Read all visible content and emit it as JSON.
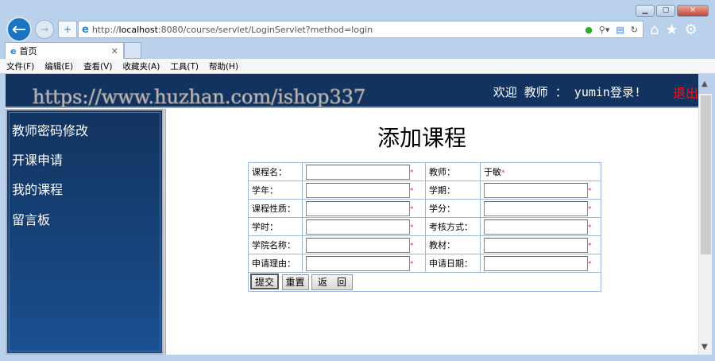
{
  "browser": {
    "url_prefix": "http://",
    "url_host": "localhost",
    "url_rest": ":8080/course/servlet/LoginServlet?method=login",
    "tab_title": "首页",
    "menu": [
      "文件(F)",
      "编辑(E)",
      "查看(V)",
      "收藏夹(A)",
      "工具(T)",
      "帮助(H)"
    ]
  },
  "header": {
    "welcome": "欢迎 教师 ： yumin登录!",
    "logout": "退出"
  },
  "sidebar": {
    "items": [
      "教师密码修改",
      "开课申请",
      "我的课程",
      "留言板"
    ]
  },
  "watermark": "https://www.huzhan.com/ishop337",
  "form": {
    "title": "添加课程",
    "teacher_label": "教师：",
    "teacher_value": "于敏",
    "rows": [
      [
        "课程名：",
        null
      ],
      [
        "学年：",
        "学期："
      ],
      [
        "课程性质：",
        "学分："
      ],
      [
        "学时：",
        "考核方式："
      ],
      [
        "学院名称：",
        "教材："
      ],
      [
        "申请理由：",
        "申请日期："
      ]
    ],
    "required_mark": "*",
    "submit": "提交",
    "reset": "重置",
    "back": "返　回"
  }
}
